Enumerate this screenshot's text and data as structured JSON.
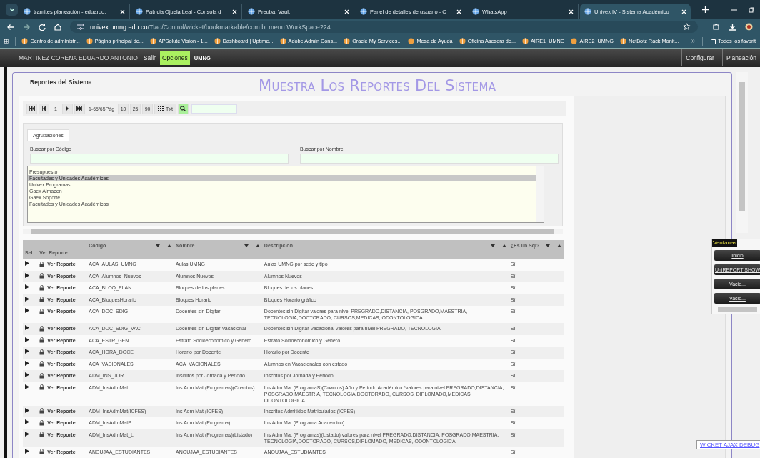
{
  "browser": {
    "tabs": [
      {
        "title": "tramites planeación - eduardo.",
        "selected": false
      },
      {
        "title": "Patricia Ojuela Leal - Consola d",
        "selected": false
      },
      {
        "title": "Preuba: Vault",
        "selected": false
      },
      {
        "title": "Panel de detalles de usuario - C",
        "selected": false
      },
      {
        "title": "WhatsApp",
        "selected": false
      },
      {
        "title": "Univex IV - Sistema Académico",
        "selected": true
      }
    ],
    "address": {
      "host": "univex.umng.edu.co",
      "path": "/Tiao/Control/wicket/bookmarkable/com.bt.menu.WorkSpace?24"
    },
    "bookmarks": [
      "Centro de administr...",
      "Página principal de...",
      "APSolute Vision - 1...",
      "Dashboard | Uptime...",
      "Adobe Admin Cons...",
      "Oracle My Services...",
      "Mesa de Ayuda",
      "Oficina Asesora de...",
      "AIRE1_UMNG",
      "AIRE2_UMNG",
      "NetBotz Rack Monit..."
    ],
    "all_bookmarks": "Todos los favorit"
  },
  "app_header": {
    "user": "MARTINEZ CORENA EDUARDO ANTONIO",
    "logout": "Salir",
    "options": "Opciones",
    "org": "UMNG",
    "menus": [
      "Configurar",
      "Planeación"
    ]
  },
  "page": {
    "section_title": "Reportes del Sistema",
    "heading": "Muestra Los Reportes Del Sistema"
  },
  "pager": {
    "page": "1",
    "range": "1-65/65Pág",
    "sizes": [
      "10",
      "25",
      "90"
    ],
    "text_export": "Txt"
  },
  "groups": {
    "tab": "Agrupaciones",
    "code_label": "Buscar por Código",
    "name_label": "Buscar por Nombre",
    "items": [
      {
        "label": "Presupuesto",
        "selected": false
      },
      {
        "label": "Facultades y Unidades Académicas",
        "selected": true
      },
      {
        "label": "Univex Programas",
        "selected": false
      },
      {
        "label": "Gaex Almacen",
        "selected": false
      },
      {
        "label": "Gaex Soporte",
        "selected": false
      },
      {
        "label": "Facultades y Unidades Académicas",
        "selected": false
      }
    ]
  },
  "table": {
    "columns": [
      {
        "label": "Sel.",
        "sortable": false
      },
      {
        "label": "Ver Reporte",
        "sortable": false
      },
      {
        "label": "Código",
        "sortable": true
      },
      {
        "label": "Nombre",
        "sortable": true
      },
      {
        "label": "Descripción",
        "sortable": true
      },
      {
        "label": "¿Es un Sql?",
        "sortable": true
      }
    ],
    "rows": [
      {
        "action": "Ver Reporte",
        "code": "ACA_AULAS_UMNG",
        "name": "Aulas UMNG",
        "description": "Aulas UMNG por sede y tipo",
        "sql": "Sí"
      },
      {
        "action": "Ver Reporte",
        "code": "ACA_Alumnos_Nuevos",
        "name": "Alumnos Nuevos",
        "description": "Alumnos Nuevos",
        "sql": "Sí"
      },
      {
        "action": "Ver Reporte",
        "code": "ACA_BLOQ_PLAN",
        "name": "Bloques de los planes",
        "description": "Bloques de los planes",
        "sql": "Sí"
      },
      {
        "action": "Ver Reporte",
        "code": "ACA_BloquesHorario",
        "name": "Bloques Horario",
        "description": "Bloques Horario gráfico",
        "sql": "Sí"
      },
      {
        "action": "Ver Reporte",
        "code": "ACA_DOC_SDIG",
        "name": "Docentes sin Digitar",
        "description": "Docentes sin Digitar valores para nivel PREGRADO,DISTANCIA, POSGRADO,MAESTRIA, TECNOLOGIA,DOCTORADO, CURSOS,MEDICAS, ODONTOLOGICA",
        "sql": "Sí"
      },
      {
        "action": "Ver Reporte",
        "code": "ACA_DOC_SDIG_VAC",
        "name": "Docentes sin Digitar Vacacional",
        "description": "Docentes sin Digitar Vacacional valores para nivel PREGRADO, TECNOLOGIA",
        "sql": "Sí"
      },
      {
        "action": "Ver Reporte",
        "code": "ACA_ESTR_GEN",
        "name": "Estrato Socioeconomico y Genero",
        "description": "Estrato Socioeconomico y Genero",
        "sql": "Sí"
      },
      {
        "action": "Ver Reporte",
        "code": "ACA_HORA_DOCE",
        "name": "Horario por Docente",
        "description": "Horario por Docente",
        "sql": "Sí"
      },
      {
        "action": "Ver Reporte",
        "code": "ACA_VACIONALES",
        "name": "ACA_VACIONALES",
        "description": "Alumnos en Vacacionales con estado",
        "sql": "Sí"
      },
      {
        "action": "Ver Reporte",
        "code": "ADM_INS_JOR",
        "name": "Inscritos por Jornada y Periodo",
        "description": "Inscritos por Jornada y Periodo",
        "sql": "Sí"
      },
      {
        "action": "Ver Reporte",
        "code": "ADM_InsAdmMat",
        "name": "Ins Adm Mat (Programas)(Cuantos)",
        "description": "Ins Adm Mat (ProgramaS)(Cuantos) Año y Periodo Académico *valores para nivel PREGRADO,DISTANCIA, POSGRADO,MAESTRIA, TECNOLOGIA,DOCTORADO, CURSOS, DIPLOMADO,MEDICAS, ODONTOLOGICA",
        "sql": "Sí"
      },
      {
        "action": "Ver Reporte",
        "code": "ADM_InsAdmMat(ICFES)",
        "name": "Ins Adm Mat (ICFES)",
        "description": "Inscritos Admitidos Matriculados (ICFES)",
        "sql": "Sí"
      },
      {
        "action": "Ver Reporte",
        "code": "ADM_InsAdmMatP",
        "name": "Ins Adm Mat (Programa)",
        "description": "Ins Adm Mat (Programa Academico)",
        "sql": "Sí"
      },
      {
        "action": "Ver Reporte",
        "code": "ADM_InsAdmMat_L",
        "name": "Ins Adm Mat (Programas)(Listado)",
        "description": "Ins Adm Mat (Programas)(Listado) valores para nivel PREGRADO,DISTANCIA, POSGRADO,MAESTRIA, TECNOLOGIA,DOCTORADO, CURSOS,DIPLOMADO, MEDICAS, ODONTOLOGICA",
        "sql": "Sí"
      },
      {
        "action": "Ver Reporte",
        "code": "ANOUJAA_ESTUDIANTES",
        "name": "ANOUJAA_ESTUDIANTES",
        "description": "ANOUJAA_ESTUDIANTES",
        "sql": "Sí"
      }
    ]
  },
  "windows_panel": {
    "title": "Ventanas",
    "buttons": [
      "Inicio",
      "UniREPORT SHOW",
      "Vacio...",
      "Vacio..."
    ]
  },
  "debug_link": "WICKET AJAX DEBUG"
}
